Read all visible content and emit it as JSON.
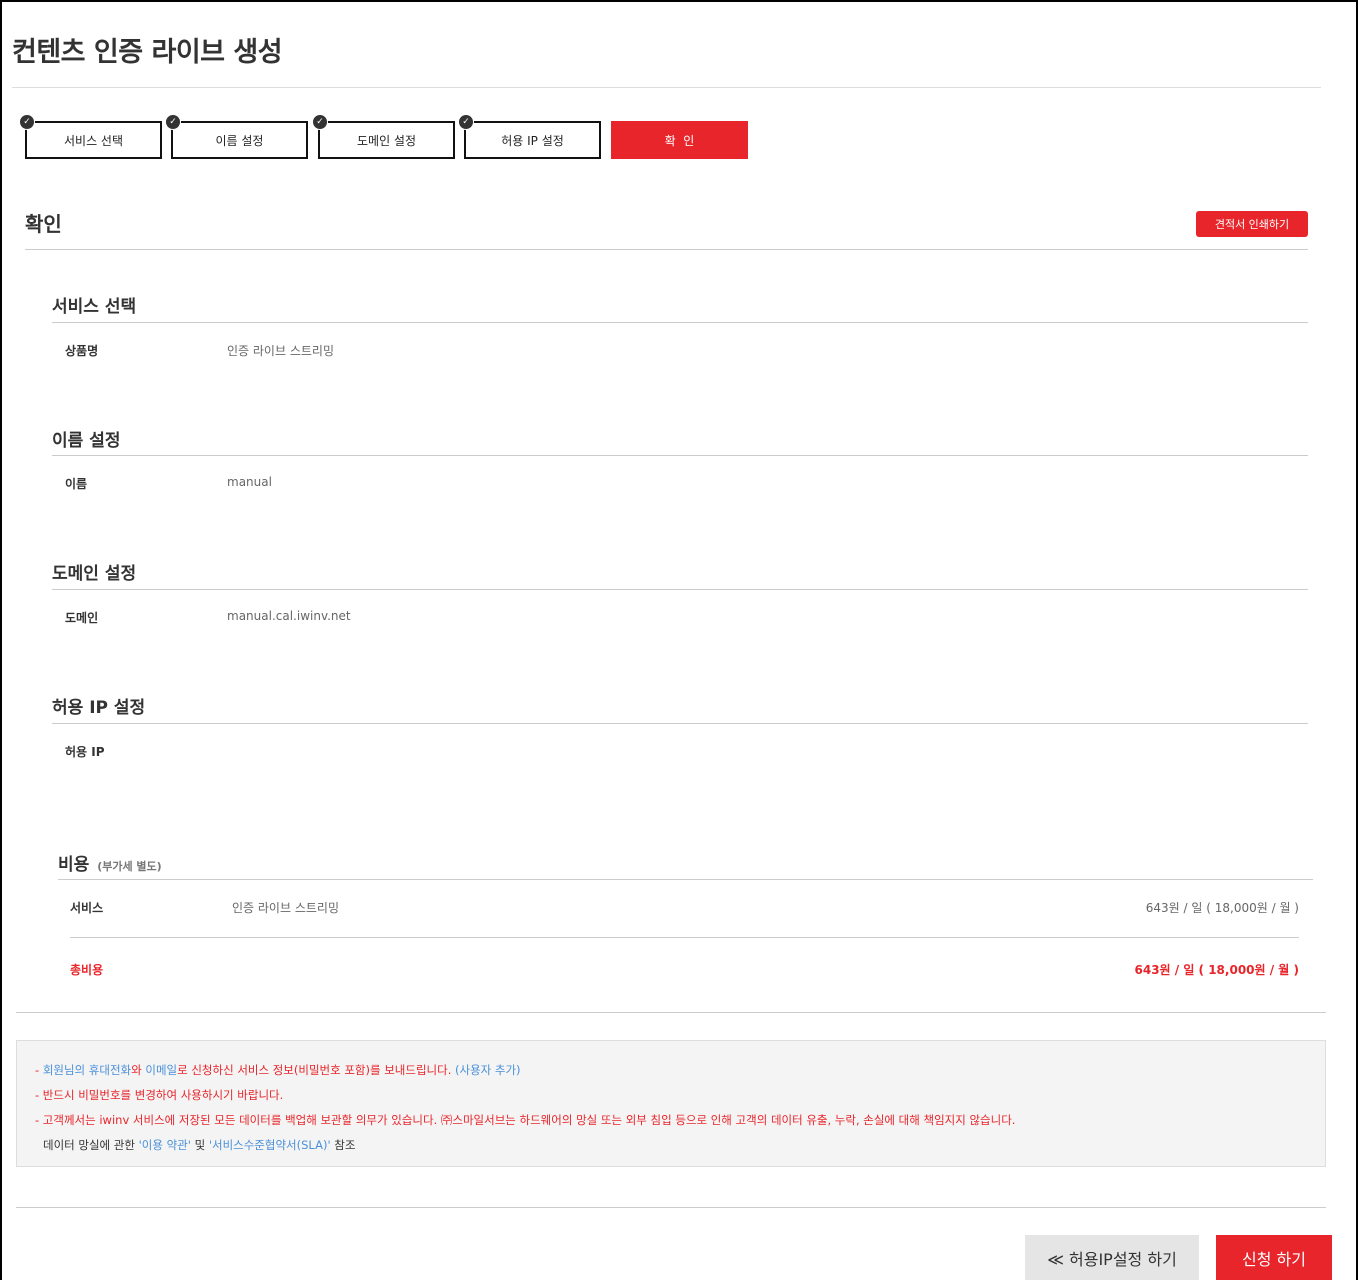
{
  "page": {
    "title": "컨텐츠 인증 라이브 생성"
  },
  "steps": [
    {
      "label": "서비스 선택",
      "done": true
    },
    {
      "label": "이름 설정",
      "done": true
    },
    {
      "label": "도메인 설정",
      "done": true
    },
    {
      "label": "허용 IP 설정",
      "done": true
    },
    {
      "label": "확  인",
      "active": true
    }
  ],
  "confirm": {
    "heading": "확인",
    "print_button": "견적서 인쇄하기"
  },
  "sections": {
    "service": {
      "heading": "서비스 선택",
      "label": "상품명",
      "value": "인증 라이브 스트리밍"
    },
    "name": {
      "heading": "이름 설정",
      "label": "이름",
      "value": "manual"
    },
    "domain": {
      "heading": "도메인 설정",
      "label": "도메인",
      "value": "manual.cal.iwinv.net"
    },
    "ip": {
      "heading": "허용 IP 설정",
      "label": "허용 IP",
      "value": ""
    }
  },
  "cost": {
    "heading": "비용",
    "heading_note": "(부가세 별도)",
    "service_label": "서비스",
    "service_desc": "인증 라이브 스트리밍",
    "service_price": "643원 / 일 ( 18,000원 / 월 )",
    "total_label": "총비용",
    "total_price": "643원 / 일 ( 18,000원 / 월 )"
  },
  "notice": {
    "l1_a": "- ",
    "l1_b": "회원님의 휴대전화",
    "l1_c": "와 ",
    "l1_d": "이메일",
    "l1_e": "로 신청하신 서비스 정보(비밀번호 포함)를 보내드립니다. ",
    "l1_f": "(사용자 추가)",
    "l2": "- 반드시 비밀번호를 변경하여 사용하시기 바랍니다.",
    "l3": "- 고객께서는 iwinv 서비스에 저장된 모든 데이터를 백업해 보관할 의무가 있습니다. ㈜스마일서브는 하드웨어의 망실 또는 외부 침입 등으로 인해 고객의 데이터 유출, 누락, 손실에 대해 책임지지 않습니다.",
    "l4_a": "데이터 망실에 관한 ",
    "l4_b": "'이용 약관'",
    "l4_c": " 및 ",
    "l4_d": "'서비스수준협약서(SLA)'",
    "l4_e": " 참조"
  },
  "buttons": {
    "back": "≪ 허용IP설정 하기",
    "submit": "신청 하기"
  },
  "colors": {
    "accent": "#e8252b",
    "link": "#4a90d9"
  }
}
